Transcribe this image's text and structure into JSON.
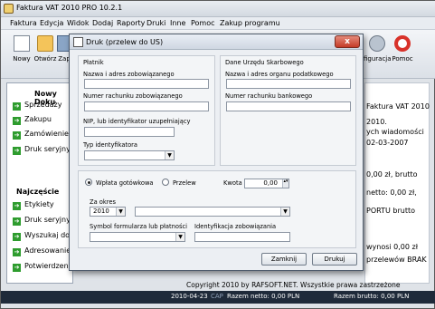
{
  "app": {
    "title": "Faktura VAT 2010 PRO 10.2.1"
  },
  "menu": [
    "Faktura",
    "Edycja",
    "Widok",
    "Dodaj",
    "Raporty",
    "Druki",
    "Inne",
    "Pomoc",
    "Zakup programu"
  ],
  "toolbar": {
    "new": "Nowy",
    "open": "Otwórz",
    "save": "Zap",
    "config": "figuracja",
    "help": "Pomoc"
  },
  "sidebar": {
    "section1": "Nowy Doku",
    "items1": [
      "Sprzedaży",
      "Zakupu",
      "Zamówienie",
      "Druk seryjny"
    ],
    "section2": "Najczęście",
    "items2": [
      "Etykiety",
      "Druk seryjny",
      "Wyszukaj dok",
      "Adresowanie",
      "Potwierdzen"
    ]
  },
  "background_text": [
    "Faktura VAT 2010",
    "2010.",
    "ych wiadomości",
    "02-03-2007",
    "0,00 zł, brutto",
    "netto: 0,00 zł,",
    "PORTU brutto",
    "wynosi 0,00 zł",
    "przelewów BRAK"
  ],
  "copyright": "Copyright 2010 by RAFSOFT.NET.  Wszystkie prawa zastrzeżone",
  "status": {
    "date": "2010-04-23",
    "cap": "CAP",
    "netto": "Razem netto: 0,00 PLN",
    "brutto": "Razem brutto: 0,00 PLN"
  },
  "dialog": {
    "title": "Druk (przelew do US)",
    "close": "x",
    "platnik": {
      "group": "Płatnik",
      "name_label": "Nazwa i adres zobowiązanego",
      "account_label": "Numer rachunku zobowiązanego",
      "nip_label": "NIP, lub identyfikator uzupełniający",
      "type_label": "Typ identyfikatora"
    },
    "urzad": {
      "group": "Dane Urzędu Skarbowego",
      "name_label": "Nazwa i adres organu podatkowego",
      "account_label": "Numer rachunku bankowego"
    },
    "payment": {
      "cash_label": "Wpłata gotówkowa",
      "transfer_label": "Przelew",
      "amount_label": "Kwota",
      "amount_value": "0,00",
      "period_label": "Za okres",
      "period_year": "2010",
      "symbol_label": "Symbol formularza lub płatności",
      "ident_label": "Identyfikacja zobowiązania"
    },
    "buttons": {
      "close": "Zamknij",
      "print": "Drukuj"
    }
  }
}
